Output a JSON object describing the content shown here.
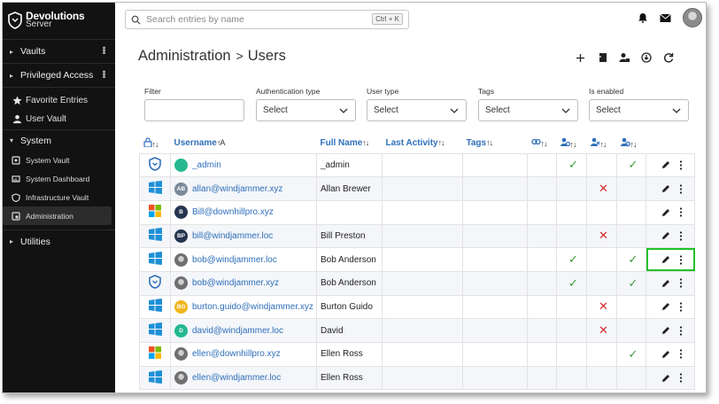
{
  "brand": {
    "line1": "Devolutions",
    "line2": "Server"
  },
  "sidebar": {
    "sections": [
      {
        "label": "Vaults",
        "kebab": true
      },
      {
        "label": "Privileged Access",
        "kebab": true
      }
    ],
    "favorites": "Favorite Entries",
    "user_vault": "User Vault",
    "system": {
      "label": "System",
      "items": [
        "System Vault",
        "System Dashboard",
        "Infrastructure Vault",
        "Administration"
      ]
    },
    "utilities": "Utilities"
  },
  "search": {
    "placeholder": "Search entries by name",
    "shortcut": "Ctrl + K"
  },
  "header": {
    "section": "Administration",
    "page": "Users",
    "separator": ">"
  },
  "filters": [
    {
      "label": "Filter",
      "value": "",
      "type": "text"
    },
    {
      "label": "Authentication type",
      "value": "Select",
      "type": "select"
    },
    {
      "label": "User type",
      "value": "Select",
      "type": "select"
    },
    {
      "label": "Tags",
      "value": "Select",
      "type": "select"
    },
    {
      "label": "Is enabled",
      "value": "Select",
      "type": "select"
    }
  ],
  "columns": {
    "username": "Username",
    "full_name": "Full Name",
    "last_activity": "Last Activity",
    "tags": "Tags"
  },
  "colors": {
    "accent": "#2f6fba",
    "check": "#3a9c3a",
    "cross": "#d62b2b",
    "highlight": "#22c02a"
  },
  "rows": [
    {
      "auth": "shield-icon",
      "initials": "",
      "avatar_color": "#24b890",
      "username": "_admin",
      "full_name": "_admin",
      "c6": "check",
      "c7": "",
      "c8": "check"
    },
    {
      "auth": "windows-icon",
      "initials": "AB",
      "avatar_color": "#7a8a99",
      "username": "allan@windjammer.xyz",
      "full_name": "Allan Brewer",
      "c6": "",
      "c7": "cross",
      "c8": ""
    },
    {
      "auth": "office-icon",
      "initials": "B",
      "avatar_color": "#26354f",
      "username": "Bill@downhillpro.xyz",
      "full_name": "",
      "c6": "",
      "c7": "",
      "c8": ""
    },
    {
      "auth": "windows-icon",
      "initials": "BP",
      "avatar_color": "#26354f",
      "username": "bill@windjammer.loc",
      "full_name": "Bill Preston",
      "c6": "",
      "c7": "cross",
      "c8": ""
    },
    {
      "auth": "windows-icon",
      "initials": "",
      "avatar_color": "photo",
      "username": "bob@windjammer.loc",
      "full_name": "Bob Anderson",
      "c6": "check",
      "c7": "",
      "c8": "check"
    },
    {
      "auth": "shield-icon",
      "initials": "",
      "avatar_color": "photo",
      "username": "bob@windjammer.xyz",
      "full_name": "Bob Anderson",
      "c6": "check",
      "c7": "",
      "c8": "check"
    },
    {
      "auth": "windows-icon",
      "initials": "BG",
      "avatar_color": "#f0b51e",
      "username": "burton.guido@windjammer.xyz",
      "full_name": "Burton Guido",
      "c6": "",
      "c7": "cross",
      "c8": ""
    },
    {
      "auth": "windows-icon",
      "initials": "D",
      "avatar_color": "#24b890",
      "username": "david@windjammer.loc",
      "full_name": "David",
      "c6": "",
      "c7": "cross",
      "c8": ""
    },
    {
      "auth": "office-icon",
      "initials": "",
      "avatar_color": "photo",
      "username": "ellen@downhillpro.xyz",
      "full_name": "Ellen Ross",
      "c6": "",
      "c7": "",
      "c8": "check"
    },
    {
      "auth": "windows-icon",
      "initials": "",
      "avatar_color": "photo",
      "username": "ellen@windjammer.loc",
      "full_name": "Ellen Ross",
      "c6": "",
      "c7": "",
      "c8": ""
    }
  ]
}
